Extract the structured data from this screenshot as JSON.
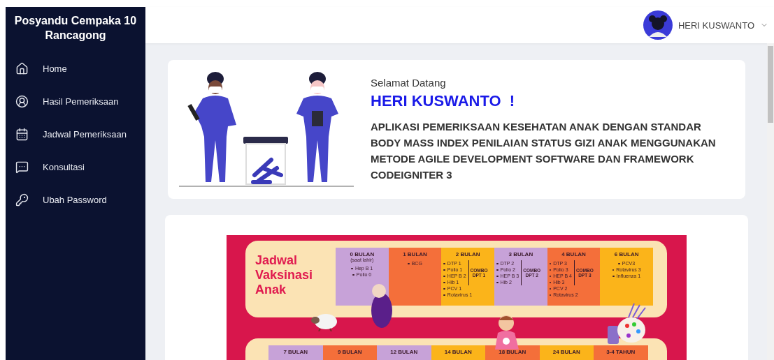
{
  "sidebar": {
    "title_lines": [
      "Posyandu Cempaka 10",
      "Rancagong"
    ],
    "items": [
      {
        "label": "Home"
      },
      {
        "label": "Hasil Pemeriksaan"
      },
      {
        "label": "Jadwal Pemeriksaan"
      },
      {
        "label": "Konsultasi"
      },
      {
        "label": "Ubah Password"
      }
    ]
  },
  "topbar": {
    "user_name": "HERI KUSWANTO"
  },
  "welcome": {
    "greeting": "Selamat Datang",
    "name": "HERI KUSWANTO  !",
    "description": "APLIKASI PEMERIKSAAN KESEHATAN ANAK DENGAN STANDAR BODY MASS INDEX PENILAIAN STATUS GIZI ANAK MENGGUNAKAN METODE AGILE DEVELOPMENT SOFTWARE DAN FRAMEWORK CODEIGNITER 3"
  },
  "poster": {
    "title_lines": [
      "Jadwal",
      "Vaksinasi",
      "Anak"
    ],
    "row_1": [
      {
        "label": "0 BULAN",
        "note": "(saat lahir)",
        "color": "#c7a2d8",
        "items": [
          "Hep B 1",
          "Polio 0"
        ]
      },
      {
        "label": "1 BULAN",
        "color": "#f46f3a",
        "items": [
          "BCG"
        ]
      },
      {
        "label": "2 BULAN",
        "color": "#fbb41a",
        "combo_items": [
          "DTP 1",
          "Polio 1",
          "HEP B 2",
          "Hib 1"
        ],
        "combo_label": [
          "COMBO",
          "DPT 1"
        ],
        "items": [
          "PCV 1",
          "Rotavirus 1"
        ]
      },
      {
        "label": "3 BULAN",
        "color": "#c7a2d8",
        "combo_items": [
          "DTP 2",
          "Polio 2",
          "HEP B 3",
          "Hib 2"
        ],
        "combo_label": [
          "COMBO",
          "DPT 2"
        ]
      },
      {
        "label": "4 BULAN",
        "color": "#f46f3a",
        "combo_items": [
          "DTP 3",
          "Polio 3",
          "HEP B 4",
          "Hib 3"
        ],
        "combo_label": [
          "COMBO",
          "DPT 3"
        ],
        "items": [
          "PCV 2",
          "Rotavirus 2"
        ]
      },
      {
        "label": "6 BULAN",
        "color": "#fbb41a",
        "items": [
          "PCV3",
          "Rotavirus 3",
          "Influenza 1"
        ]
      }
    ],
    "row_2": [
      {
        "label": "7 BULAN",
        "color": "#c7a2d8"
      },
      {
        "label": "9 BULAN",
        "color": "#f46f3a"
      },
      {
        "label": "12 BULAN",
        "color": "#c7a2d8"
      },
      {
        "label": "14 BULAN",
        "color": "#fbb41a"
      },
      {
        "label": "18 BULAN",
        "color": "#f46f3a"
      },
      {
        "label": "24 BULAN",
        "color": "#fbb41a"
      },
      {
        "label": "3-4 TAHUN",
        "color": "#f46f3a"
      }
    ]
  }
}
